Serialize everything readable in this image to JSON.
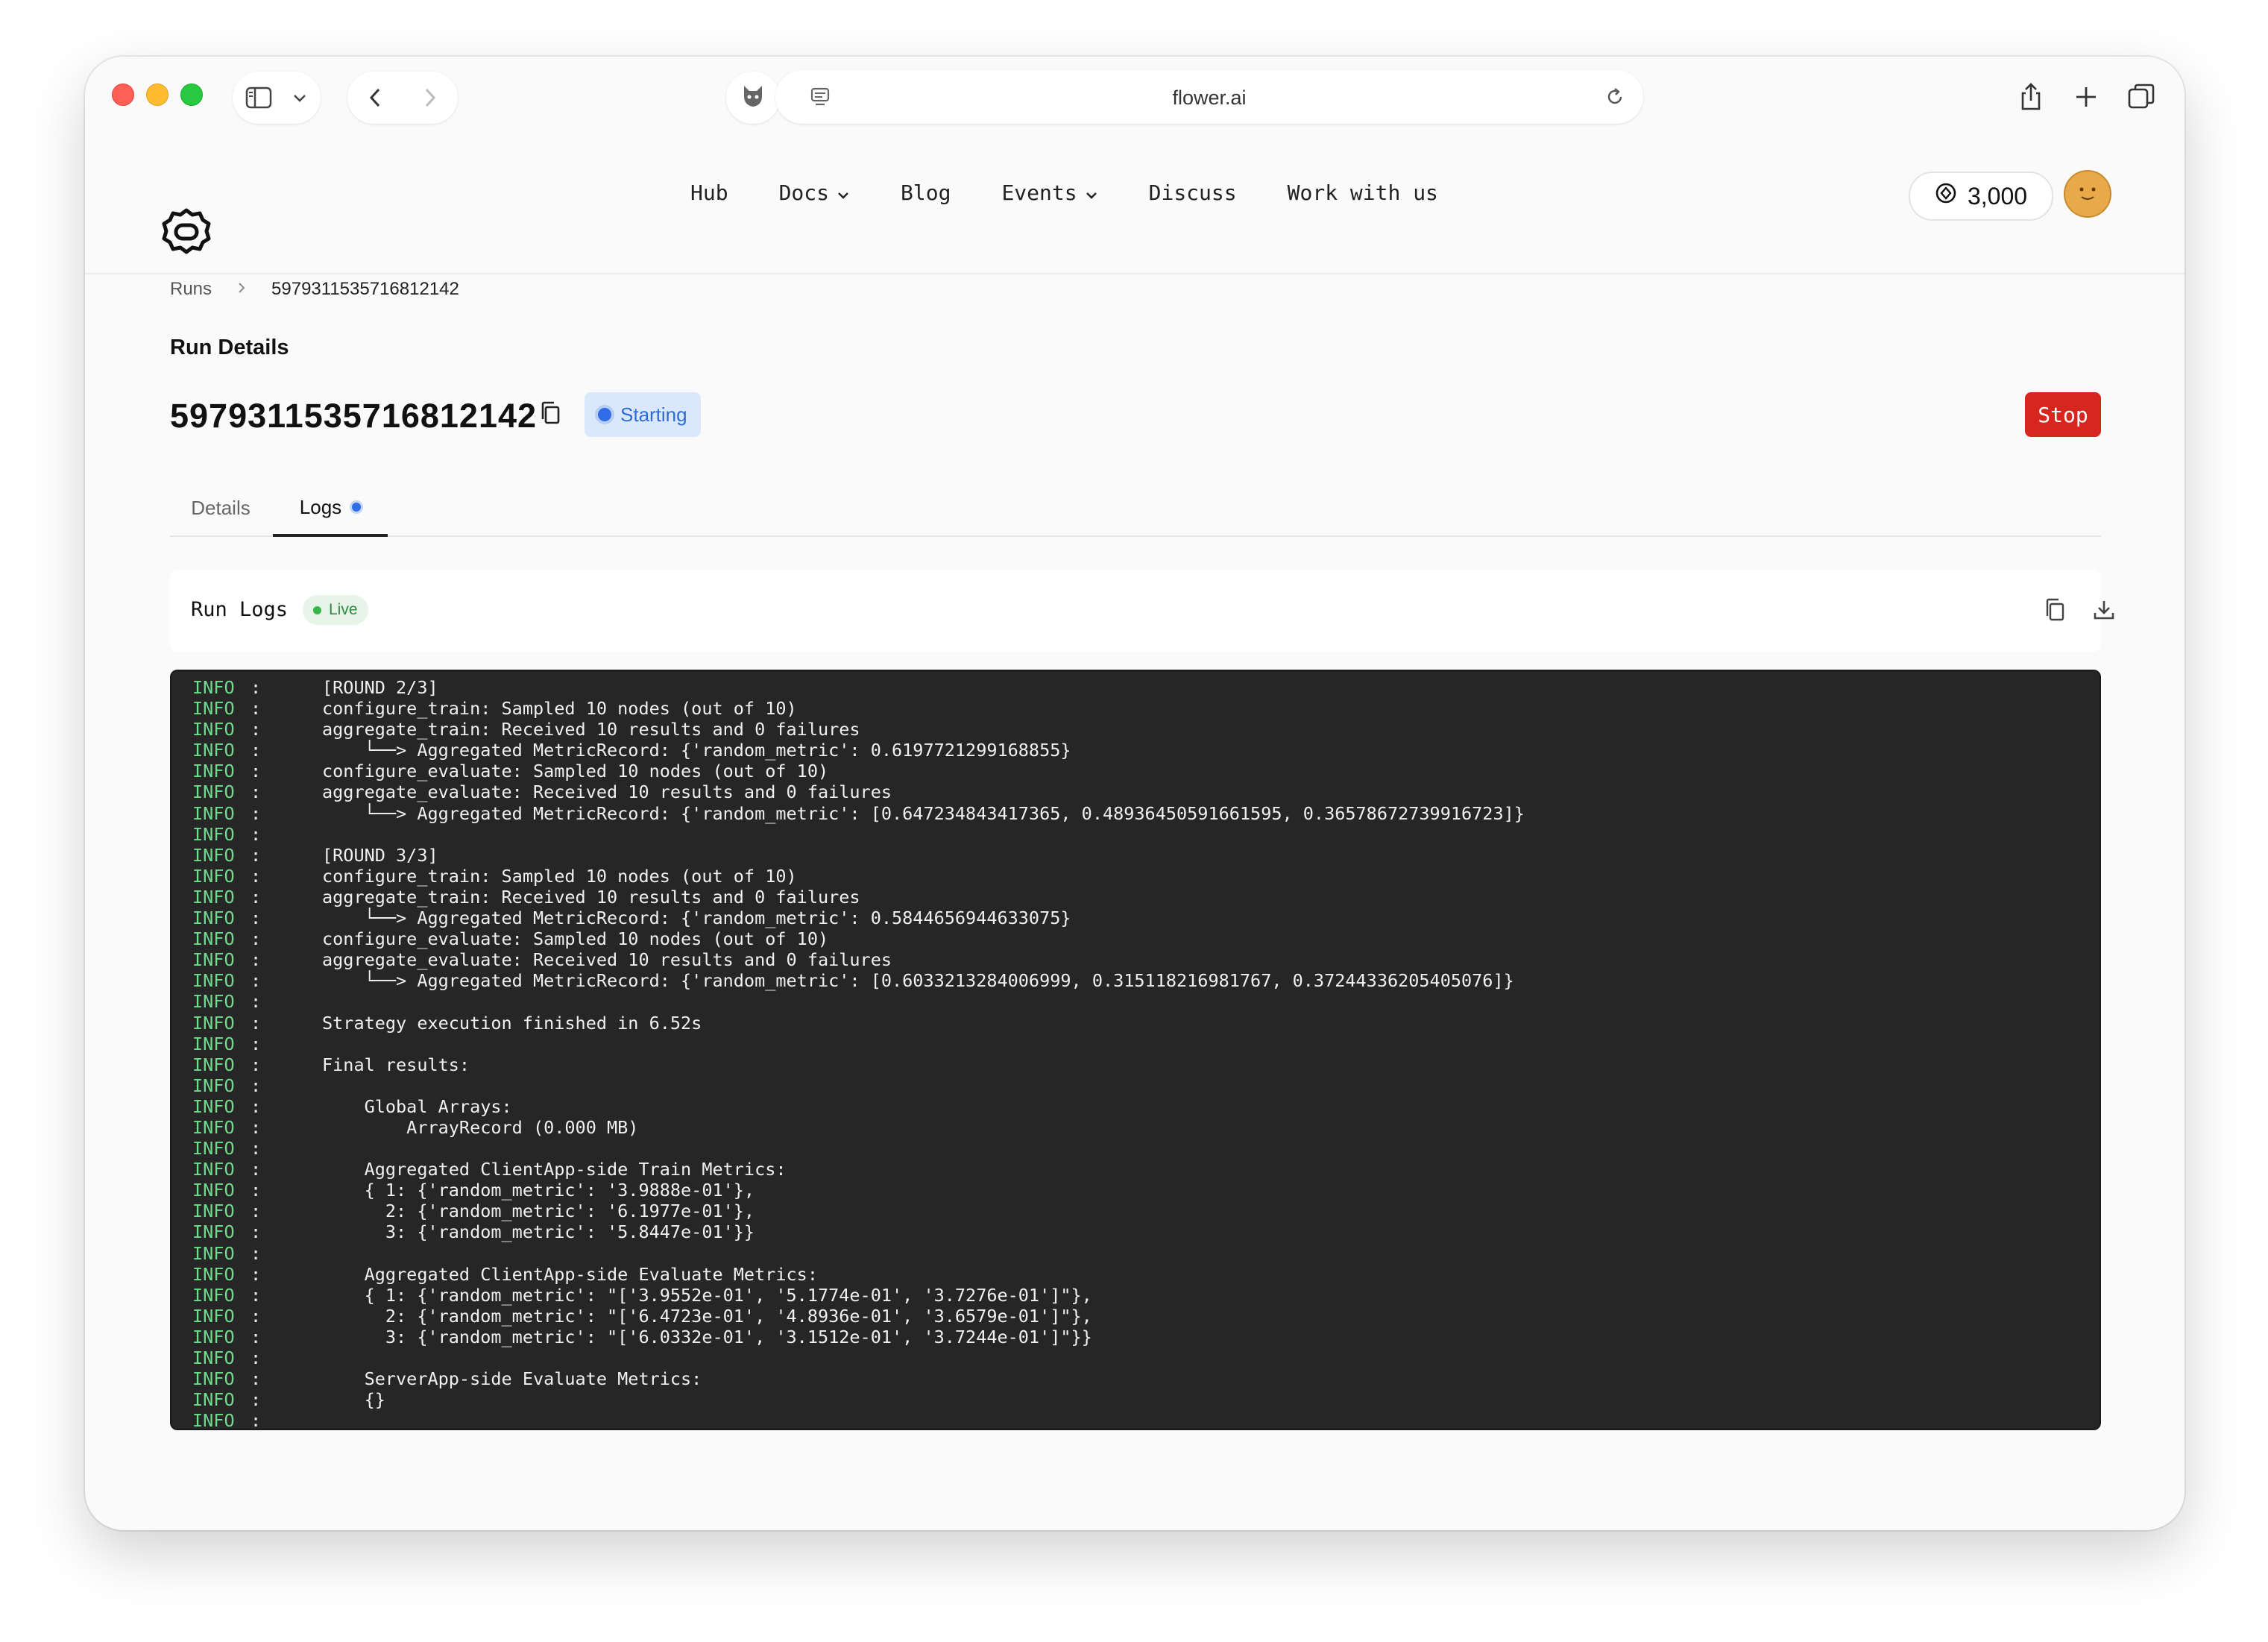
{
  "browser": {
    "url": "flower.ai"
  },
  "nav": {
    "items": [
      {
        "label": "Hub",
        "dropdown": false
      },
      {
        "label": "Docs",
        "dropdown": true
      },
      {
        "label": "Blog",
        "dropdown": false
      },
      {
        "label": "Events",
        "dropdown": true
      },
      {
        "label": "Discuss",
        "dropdown": false
      },
      {
        "label": "Work with us",
        "dropdown": false
      }
    ],
    "credits": "3,000"
  },
  "breadcrumb": {
    "root": "Runs",
    "current": "5979311535716812142"
  },
  "page": {
    "section_label": "Run Details",
    "run_id": "5979311535716812142",
    "status": "Starting",
    "stop_label": "Stop"
  },
  "tabs": [
    {
      "label": "Details",
      "active": false
    },
    {
      "label": "Logs",
      "active": true
    }
  ],
  "logs": {
    "title": "Run Logs",
    "live_label": "Live",
    "lines": [
      {
        "level": "INFO",
        "message": "[ROUND 2/3]"
      },
      {
        "level": "INFO",
        "message": "configure_train: Sampled 10 nodes (out of 10)"
      },
      {
        "level": "INFO",
        "message": "aggregate_train: Received 10 results and 0 failures"
      },
      {
        "level": "INFO",
        "message": "    └──> Aggregated MetricRecord: {'random_metric': 0.6197721299168855}"
      },
      {
        "level": "INFO",
        "message": "configure_evaluate: Sampled 10 nodes (out of 10)"
      },
      {
        "level": "INFO",
        "message": "aggregate_evaluate: Received 10 results and 0 failures"
      },
      {
        "level": "INFO",
        "message": "    └──> Aggregated MetricRecord: {'random_metric': [0.647234843417365, 0.48936450591661595, 0.36578672739916723]}"
      },
      {
        "level": "INFO",
        "message": ""
      },
      {
        "level": "INFO",
        "message": "[ROUND 3/3]"
      },
      {
        "level": "INFO",
        "message": "configure_train: Sampled 10 nodes (out of 10)"
      },
      {
        "level": "INFO",
        "message": "aggregate_train: Received 10 results and 0 failures"
      },
      {
        "level": "INFO",
        "message": "    └──> Aggregated MetricRecord: {'random_metric': 0.5844656944633075}"
      },
      {
        "level": "INFO",
        "message": "configure_evaluate: Sampled 10 nodes (out of 10)"
      },
      {
        "level": "INFO",
        "message": "aggregate_evaluate: Received 10 results and 0 failures"
      },
      {
        "level": "INFO",
        "message": "    └──> Aggregated MetricRecord: {'random_metric': [0.6033213284006999, 0.315118216981767, 0.37244336205405076]}"
      },
      {
        "level": "INFO",
        "message": ""
      },
      {
        "level": "INFO",
        "message": "Strategy execution finished in 6.52s"
      },
      {
        "level": "INFO",
        "message": ""
      },
      {
        "level": "INFO",
        "message": "Final results:"
      },
      {
        "level": "INFO",
        "message": ""
      },
      {
        "level": "INFO",
        "message": "    Global Arrays:"
      },
      {
        "level": "INFO",
        "message": "        ArrayRecord (0.000 MB)"
      },
      {
        "level": "INFO",
        "message": ""
      },
      {
        "level": "INFO",
        "message": "    Aggregated ClientApp-side Train Metrics:"
      },
      {
        "level": "INFO",
        "message": "    { 1: {'random_metric': '3.9888e-01'},"
      },
      {
        "level": "INFO",
        "message": "      2: {'random_metric': '6.1977e-01'},"
      },
      {
        "level": "INFO",
        "message": "      3: {'random_metric': '5.8447e-01'}}"
      },
      {
        "level": "INFO",
        "message": ""
      },
      {
        "level": "INFO",
        "message": "    Aggregated ClientApp-side Evaluate Metrics:"
      },
      {
        "level": "INFO",
        "message": "    { 1: {'random_metric': \"['3.9552e-01', '5.1774e-01', '3.7276e-01']\"},"
      },
      {
        "level": "INFO",
        "message": "      2: {'random_metric': \"['6.4723e-01', '4.8936e-01', '3.6579e-01']\"},"
      },
      {
        "level": "INFO",
        "message": "      3: {'random_metric': \"['6.0332e-01', '3.1512e-01', '3.7244e-01']\"}}"
      },
      {
        "level": "INFO",
        "message": ""
      },
      {
        "level": "INFO",
        "message": "    ServerApp-side Evaluate Metrics:"
      },
      {
        "level": "INFO",
        "message": "    {}"
      },
      {
        "level": "INFO",
        "message": ""
      }
    ]
  },
  "colors": {
    "stop": "#d7261e",
    "status_bg": "#dbe8fb",
    "status_text": "#2d6bd6",
    "live_bg": "#e6f5e8",
    "log_level": "#6fdc8c",
    "console_bg": "#262626"
  }
}
